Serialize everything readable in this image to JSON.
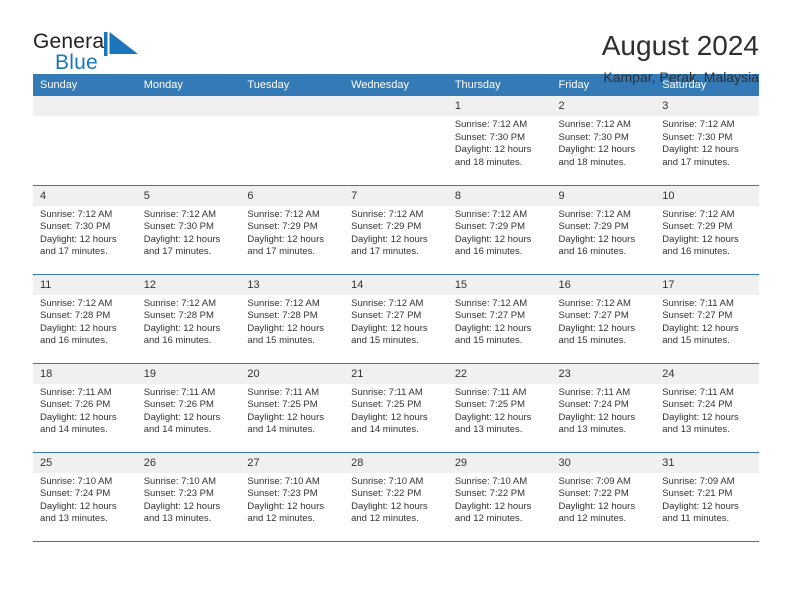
{
  "brand": {
    "line1": "General",
    "line2": "Blue",
    "mark": "triangle-flag-icon",
    "accent_color": "#1b75bb",
    "text_color": "#231f20"
  },
  "header": {
    "title": "August 2024",
    "subtitle": "Kampar, Perak, Malaysia"
  },
  "theme": {
    "header_row_bg": "#337ab7",
    "header_row_text": "#ffffff",
    "daynum_bg": "#f0f0f0",
    "row_divider": "#337ab7",
    "body_text": "#333333"
  },
  "weekday_headers": [
    "Sunday",
    "Monday",
    "Tuesday",
    "Wednesday",
    "Thursday",
    "Friday",
    "Saturday"
  ],
  "labels": {
    "sunrise_prefix": "Sunrise:",
    "sunset_prefix": "Sunset:",
    "daylight_prefix": "Daylight:"
  },
  "weeks": [
    [
      {
        "day": "",
        "empty": true,
        "sunrise": "",
        "sunset": "",
        "daylight": ""
      },
      {
        "day": "",
        "empty": true,
        "sunrise": "",
        "sunset": "",
        "daylight": ""
      },
      {
        "day": "",
        "empty": true,
        "sunrise": "",
        "sunset": "",
        "daylight": ""
      },
      {
        "day": "",
        "empty": true,
        "sunrise": "",
        "sunset": "",
        "daylight": ""
      },
      {
        "day": "1",
        "empty": false,
        "sunrise": "Sunrise: 7:12 AM",
        "sunset": "Sunset: 7:30 PM",
        "daylight": "Daylight: 12 hours and 18 minutes."
      },
      {
        "day": "2",
        "empty": false,
        "sunrise": "Sunrise: 7:12 AM",
        "sunset": "Sunset: 7:30 PM",
        "daylight": "Daylight: 12 hours and 18 minutes."
      },
      {
        "day": "3",
        "empty": false,
        "sunrise": "Sunrise: 7:12 AM",
        "sunset": "Sunset: 7:30 PM",
        "daylight": "Daylight: 12 hours and 17 minutes."
      }
    ],
    [
      {
        "day": "4",
        "empty": false,
        "sunrise": "Sunrise: 7:12 AM",
        "sunset": "Sunset: 7:30 PM",
        "daylight": "Daylight: 12 hours and 17 minutes."
      },
      {
        "day": "5",
        "empty": false,
        "sunrise": "Sunrise: 7:12 AM",
        "sunset": "Sunset: 7:30 PM",
        "daylight": "Daylight: 12 hours and 17 minutes."
      },
      {
        "day": "6",
        "empty": false,
        "sunrise": "Sunrise: 7:12 AM",
        "sunset": "Sunset: 7:29 PM",
        "daylight": "Daylight: 12 hours and 17 minutes."
      },
      {
        "day": "7",
        "empty": false,
        "sunrise": "Sunrise: 7:12 AM",
        "sunset": "Sunset: 7:29 PM",
        "daylight": "Daylight: 12 hours and 17 minutes."
      },
      {
        "day": "8",
        "empty": false,
        "sunrise": "Sunrise: 7:12 AM",
        "sunset": "Sunset: 7:29 PM",
        "daylight": "Daylight: 12 hours and 16 minutes."
      },
      {
        "day": "9",
        "empty": false,
        "sunrise": "Sunrise: 7:12 AM",
        "sunset": "Sunset: 7:29 PM",
        "daylight": "Daylight: 12 hours and 16 minutes."
      },
      {
        "day": "10",
        "empty": false,
        "sunrise": "Sunrise: 7:12 AM",
        "sunset": "Sunset: 7:29 PM",
        "daylight": "Daylight: 12 hours and 16 minutes."
      }
    ],
    [
      {
        "day": "11",
        "empty": false,
        "sunrise": "Sunrise: 7:12 AM",
        "sunset": "Sunset: 7:28 PM",
        "daylight": "Daylight: 12 hours and 16 minutes."
      },
      {
        "day": "12",
        "empty": false,
        "sunrise": "Sunrise: 7:12 AM",
        "sunset": "Sunset: 7:28 PM",
        "daylight": "Daylight: 12 hours and 16 minutes."
      },
      {
        "day": "13",
        "empty": false,
        "sunrise": "Sunrise: 7:12 AM",
        "sunset": "Sunset: 7:28 PM",
        "daylight": "Daylight: 12 hours and 15 minutes."
      },
      {
        "day": "14",
        "empty": false,
        "sunrise": "Sunrise: 7:12 AM",
        "sunset": "Sunset: 7:27 PM",
        "daylight": "Daylight: 12 hours and 15 minutes."
      },
      {
        "day": "15",
        "empty": false,
        "sunrise": "Sunrise: 7:12 AM",
        "sunset": "Sunset: 7:27 PM",
        "daylight": "Daylight: 12 hours and 15 minutes."
      },
      {
        "day": "16",
        "empty": false,
        "sunrise": "Sunrise: 7:12 AM",
        "sunset": "Sunset: 7:27 PM",
        "daylight": "Daylight: 12 hours and 15 minutes."
      },
      {
        "day": "17",
        "empty": false,
        "sunrise": "Sunrise: 7:11 AM",
        "sunset": "Sunset: 7:27 PM",
        "daylight": "Daylight: 12 hours and 15 minutes."
      }
    ],
    [
      {
        "day": "18",
        "empty": false,
        "sunrise": "Sunrise: 7:11 AM",
        "sunset": "Sunset: 7:26 PM",
        "daylight": "Daylight: 12 hours and 14 minutes."
      },
      {
        "day": "19",
        "empty": false,
        "sunrise": "Sunrise: 7:11 AM",
        "sunset": "Sunset: 7:26 PM",
        "daylight": "Daylight: 12 hours and 14 minutes."
      },
      {
        "day": "20",
        "empty": false,
        "sunrise": "Sunrise: 7:11 AM",
        "sunset": "Sunset: 7:25 PM",
        "daylight": "Daylight: 12 hours and 14 minutes."
      },
      {
        "day": "21",
        "empty": false,
        "sunrise": "Sunrise: 7:11 AM",
        "sunset": "Sunset: 7:25 PM",
        "daylight": "Daylight: 12 hours and 14 minutes."
      },
      {
        "day": "22",
        "empty": false,
        "sunrise": "Sunrise: 7:11 AM",
        "sunset": "Sunset: 7:25 PM",
        "daylight": "Daylight: 12 hours and 13 minutes."
      },
      {
        "day": "23",
        "empty": false,
        "sunrise": "Sunrise: 7:11 AM",
        "sunset": "Sunset: 7:24 PM",
        "daylight": "Daylight: 12 hours and 13 minutes."
      },
      {
        "day": "24",
        "empty": false,
        "sunrise": "Sunrise: 7:11 AM",
        "sunset": "Sunset: 7:24 PM",
        "daylight": "Daylight: 12 hours and 13 minutes."
      }
    ],
    [
      {
        "day": "25",
        "empty": false,
        "sunrise": "Sunrise: 7:10 AM",
        "sunset": "Sunset: 7:24 PM",
        "daylight": "Daylight: 12 hours and 13 minutes."
      },
      {
        "day": "26",
        "empty": false,
        "sunrise": "Sunrise: 7:10 AM",
        "sunset": "Sunset: 7:23 PM",
        "daylight": "Daylight: 12 hours and 13 minutes."
      },
      {
        "day": "27",
        "empty": false,
        "sunrise": "Sunrise: 7:10 AM",
        "sunset": "Sunset: 7:23 PM",
        "daylight": "Daylight: 12 hours and 12 minutes."
      },
      {
        "day": "28",
        "empty": false,
        "sunrise": "Sunrise: 7:10 AM",
        "sunset": "Sunset: 7:22 PM",
        "daylight": "Daylight: 12 hours and 12 minutes."
      },
      {
        "day": "29",
        "empty": false,
        "sunrise": "Sunrise: 7:10 AM",
        "sunset": "Sunset: 7:22 PM",
        "daylight": "Daylight: 12 hours and 12 minutes."
      },
      {
        "day": "30",
        "empty": false,
        "sunrise": "Sunrise: 7:09 AM",
        "sunset": "Sunset: 7:22 PM",
        "daylight": "Daylight: 12 hours and 12 minutes."
      },
      {
        "day": "31",
        "empty": false,
        "sunrise": "Sunrise: 7:09 AM",
        "sunset": "Sunset: 7:21 PM",
        "daylight": "Daylight: 12 hours and 11 minutes."
      }
    ]
  ]
}
